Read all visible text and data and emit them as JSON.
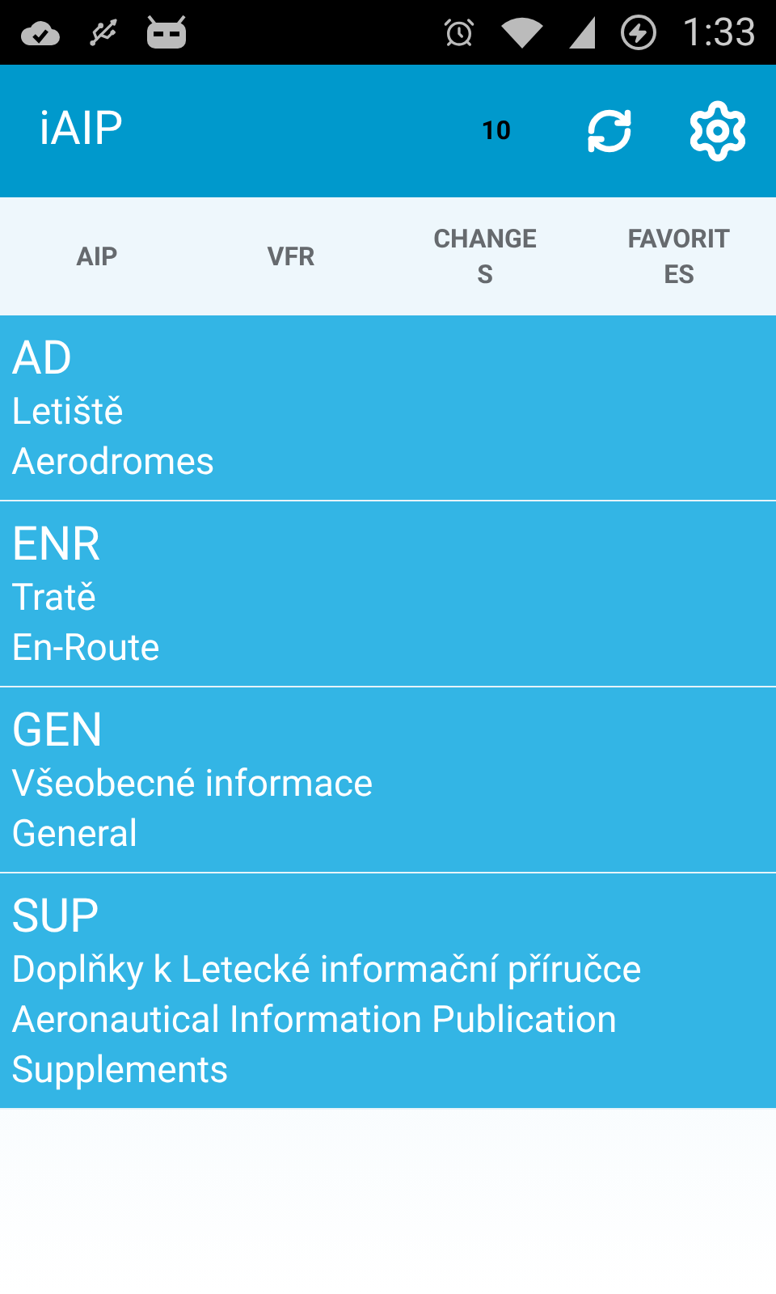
{
  "status_bar": {
    "time": "1:33"
  },
  "action_bar": {
    "title": "iAIP",
    "count": "10"
  },
  "tabs": [
    {
      "label": "AIP"
    },
    {
      "label": "VFR"
    },
    {
      "label": "CHANGES"
    },
    {
      "label": "FAVORITES"
    }
  ],
  "sections": [
    {
      "code": "AD",
      "lines": [
        "Letiště",
        "Aerodromes"
      ]
    },
    {
      "code": "ENR",
      "lines": [
        "Tratě",
        "En-Route"
      ]
    },
    {
      "code": "GEN",
      "lines": [
        "Všeobecné informace",
        "General"
      ]
    },
    {
      "code": "SUP",
      "lines": [
        "Doplňky k Letecké informační příručce",
        "Aeronautical Information Publication Supplements"
      ]
    }
  ]
}
